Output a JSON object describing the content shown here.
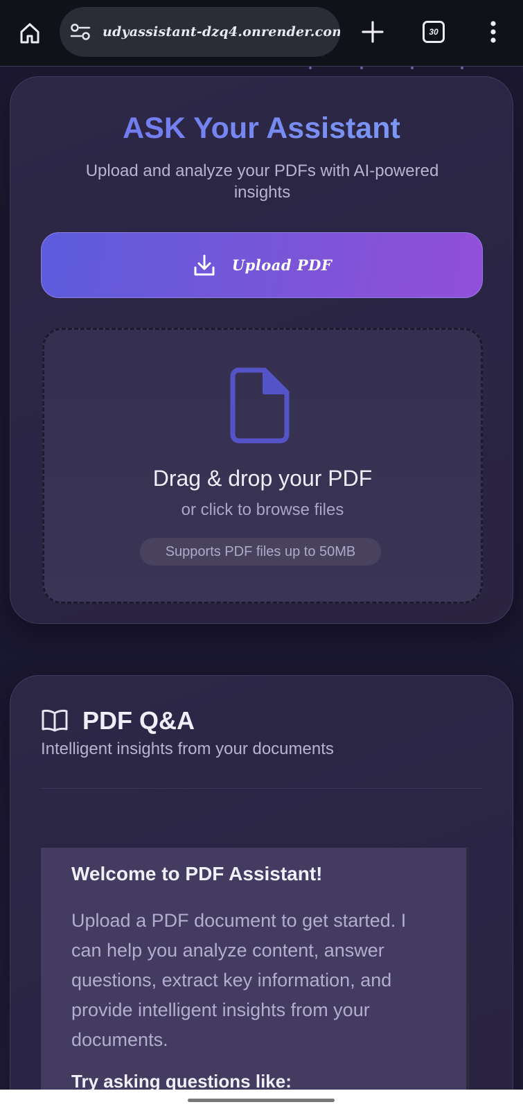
{
  "browser": {
    "url": "udyassistant-dzq4.onrender.com",
    "tab_count": "30",
    "icons": {
      "home": "home-icon",
      "site_settings": "tune-icon",
      "new_tab": "plus-icon",
      "tabs": "tab-switcher-icon",
      "menu": "more-vert-icon"
    }
  },
  "upload_card": {
    "title": "ASK Your Assistant",
    "subtitle": "Upload and analyze your PDFs with AI-powered insights",
    "upload_button_label": "Upload PDF",
    "dropzone": {
      "title": "Drag & drop your PDF",
      "subtitle": "or click to browse files",
      "badge": "Supports PDF files up to 50MB"
    }
  },
  "qa_card": {
    "title": "PDF Q&A",
    "subtitle": "Intelligent insights from your documents",
    "welcome": {
      "title": "Welcome to PDF Assistant!",
      "body": "Upload a PDF document to get started. I can help you analyze content, answer questions, extract key information, and provide intelligent insights from your documents.",
      "prompt": "Try asking questions like:"
    }
  },
  "colors": {
    "accent_start": "#5c5cdc",
    "accent_end": "#934fd9",
    "title_gradient_start": "#6f6ff0",
    "title_gradient_end": "#7fa3f4",
    "page_background": "#1d1932",
    "card_background": "#2d2846",
    "file_icon": "#5553c8"
  }
}
